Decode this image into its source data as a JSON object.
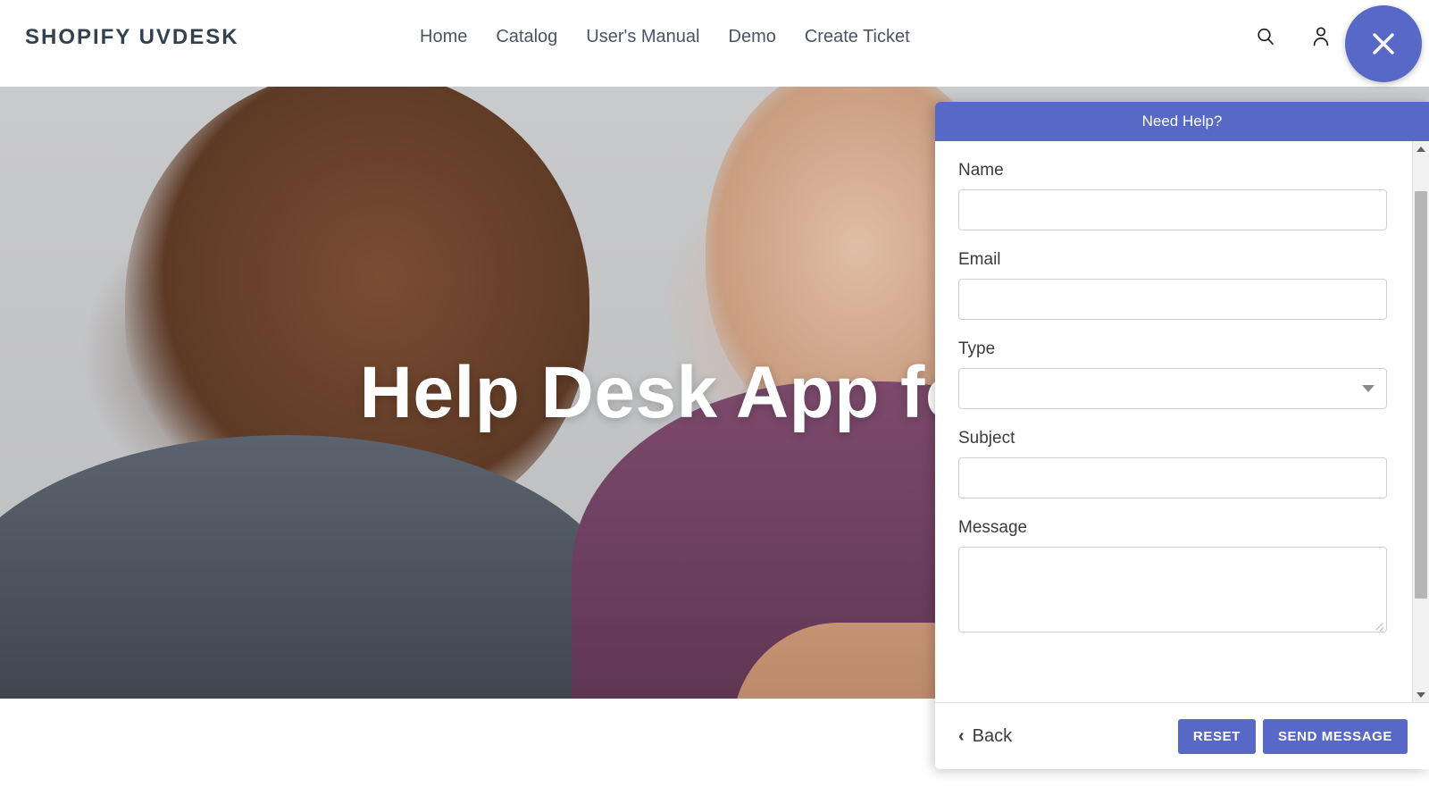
{
  "header": {
    "logo": "SHOPIFY UVDESK",
    "nav": [
      {
        "label": "Home"
      },
      {
        "label": "Catalog"
      },
      {
        "label": "User's Manual"
      },
      {
        "label": "Demo"
      },
      {
        "label": "Create Ticket"
      }
    ],
    "icons": {
      "search": "search-icon",
      "account": "user-icon",
      "close": "close-icon"
    },
    "accent_color": "#5868c6"
  },
  "hero": {
    "title": "Help Desk App for S"
  },
  "help_panel": {
    "title": "Need Help?",
    "fields": {
      "name": {
        "label": "Name",
        "value": "",
        "placeholder": ""
      },
      "email": {
        "label": "Email",
        "value": "",
        "placeholder": ""
      },
      "type": {
        "label": "Type",
        "value": "",
        "options": []
      },
      "subject": {
        "label": "Subject",
        "value": "",
        "placeholder": ""
      },
      "message": {
        "label": "Message",
        "value": "",
        "placeholder": ""
      }
    },
    "footer": {
      "back_label": "Back",
      "back_chevron": "‹",
      "reset_label": "RESET",
      "send_label": "SEND MESSAGE"
    },
    "header_color": "#5868c6",
    "button_color": "#5868c6"
  }
}
